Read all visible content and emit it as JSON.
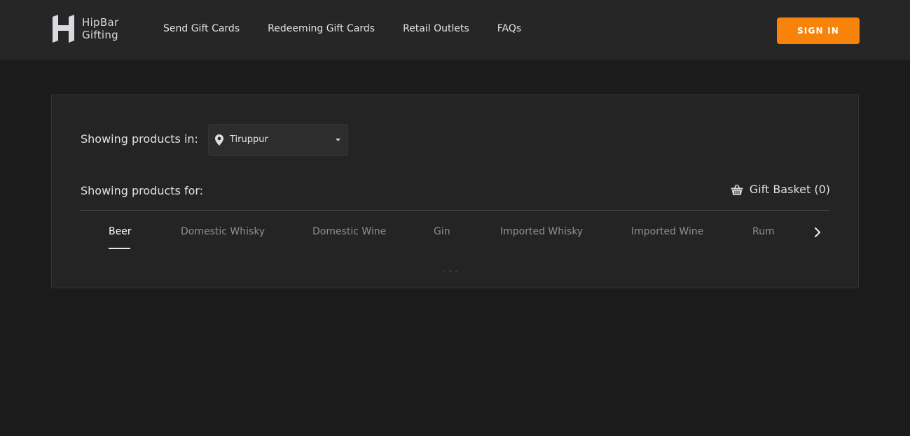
{
  "header": {
    "logo": {
      "line1": "HipBar",
      "line2": "Gifting"
    },
    "nav": [
      {
        "label": "Send Gift Cards"
      },
      {
        "label": "Redeeming Gift Cards"
      },
      {
        "label": "Retail Outlets"
      },
      {
        "label": "FAQs"
      }
    ],
    "signin_label": "SIGN IN"
  },
  "location": {
    "label": "Showing products in:",
    "selected": "Tiruppur",
    "icon": "map-pin-icon"
  },
  "products": {
    "label": "Showing products for:",
    "basket": {
      "label": "Gift Basket (0)",
      "icon": "basket-icon"
    },
    "categories": [
      {
        "label": "Beer",
        "active": true
      },
      {
        "label": "Domestic Whisky"
      },
      {
        "label": "Domestic Wine"
      },
      {
        "label": "Gin"
      },
      {
        "label": "Imported Whisky"
      },
      {
        "label": "Imported Wine"
      },
      {
        "label": "Rum"
      }
    ]
  },
  "colors": {
    "accent": "#f7830a",
    "page_bg": "#1b1b1b",
    "header_bg": "#262626",
    "panel_bg": "#242424"
  }
}
